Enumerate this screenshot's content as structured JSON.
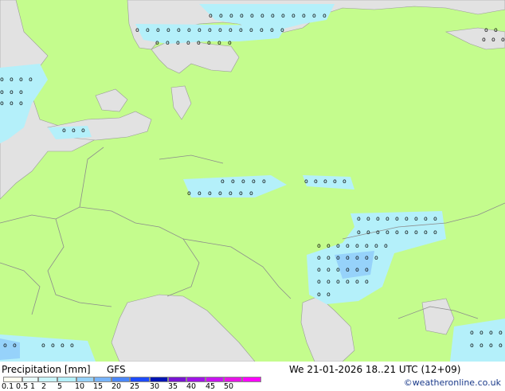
{
  "map": {
    "colors": {
      "land": "#c4fc8d",
      "sea": "#e2e2e2",
      "precip_light": "#b4f0fa",
      "precip_medium": "#96d2fa",
      "border": "#8c8c8c"
    },
    "markers": "o",
    "marker_rows": [
      {
        "n": "row-1",
        "cls": "o",
        "count": 17
      },
      {
        "n": "row-2",
        "cls": "o",
        "count": 11
      },
      {
        "n": "row-3",
        "cls": "o",
        "count": 10
      }
    ]
  },
  "legend": {
    "title": "Precipitation [mm]",
    "model": "GFS",
    "datetime": "We 21-01-2026 18..21 UTC (12+09)",
    "credit": "©weatheronline.co.uk",
    "scale_labels": [
      "0.1",
      "0.5",
      "1",
      "2",
      "5",
      "10",
      "15",
      "20",
      "25",
      "30",
      "35",
      "40",
      "45",
      "50"
    ],
    "scale_colors": [
      "#fffff0",
      "#e6fafa",
      "#c8f5fa",
      "#b4f0fa",
      "#96d2fa",
      "#78b4fa",
      "#4b87fa",
      "#1e4bfa",
      "#0014b4",
      "#7814d2",
      "#a014e6",
      "#c814f0",
      "#e614e6",
      "#ff00ff"
    ]
  }
}
